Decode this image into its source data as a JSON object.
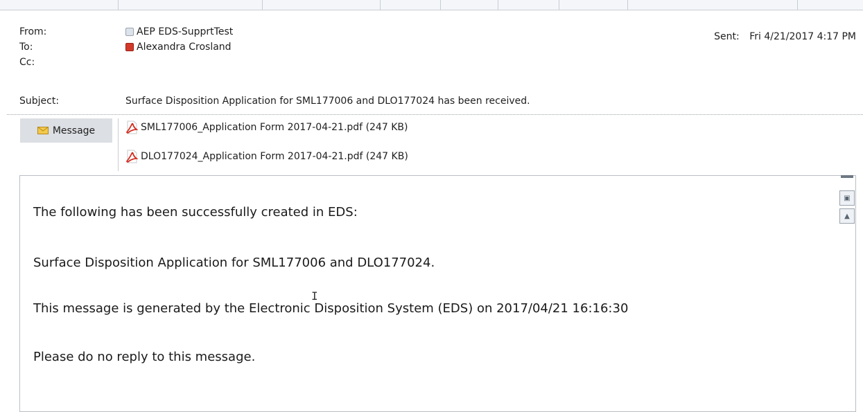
{
  "header": {
    "from_label": "From:",
    "from_value": "AEP EDS-SupprtTest",
    "to_label": "To:",
    "to_value": "Alexandra Crosland",
    "cc_label": "Cc:",
    "subject_label": "Subject:",
    "subject_value": "Surface Disposition Application for SML177006 and DLO177024 has been received.",
    "sent_label": "Sent:",
    "sent_value": "Fri 4/21/2017 4:17 PM"
  },
  "tabs": {
    "message_label": "Message"
  },
  "attachments": [
    {
      "name": "SML177006_Application Form 2017-04-21.pdf (247 KB)",
      "icon": "pdf-icon"
    },
    {
      "name": "DLO177024_Application Form 2017-04-21.pdf (247 KB)",
      "icon": "pdf-icon"
    }
  ],
  "body": {
    "line1": "The following has been successfully created in EDS:",
    "line2": "Surface Disposition Application for SML177006 and DLO177024.",
    "line3": "This message is generated by the Electronic Disposition System (EDS) on 2017/04/21 16:16:30",
    "line4": "Please do no reply to this message."
  },
  "colors": {
    "accent_red": "#d13a2a",
    "tab_bg": "#dcdfe3",
    "envelope": "#f2c94c"
  }
}
